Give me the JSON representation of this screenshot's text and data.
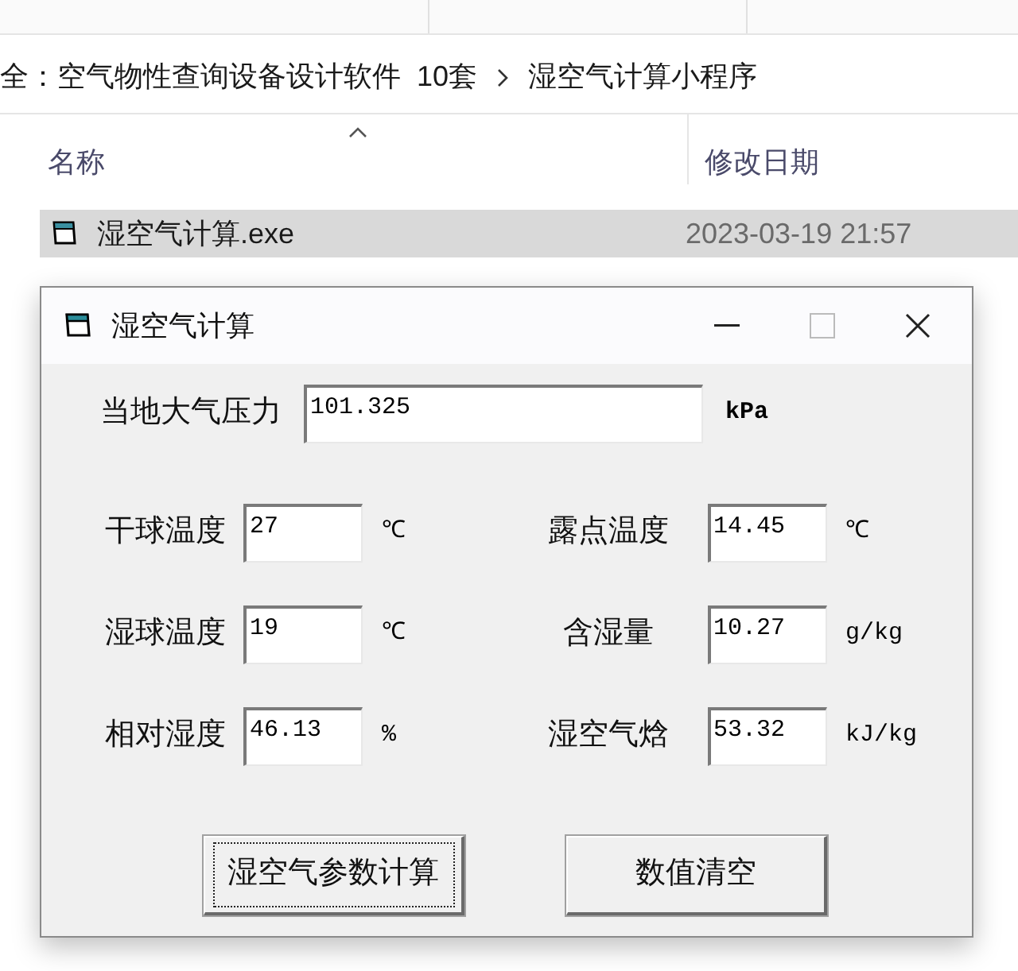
{
  "explorer": {
    "breadcrumb": [
      "全：空气物性查询设备设计软件  10套",
      "湿空气计算小程序"
    ],
    "columns": [
      {
        "label": "名称",
        "sorted": true
      },
      {
        "label": "修改日期",
        "sorted": false
      }
    ],
    "files": [
      {
        "name": "湿空气计算.exe",
        "date": "2023-03-19 21:57",
        "selected": true
      }
    ]
  },
  "dialog": {
    "title": "湿空气计算",
    "pressure": {
      "label": "当地大气压力",
      "value": "101.325",
      "unit": "kPa"
    },
    "fields": [
      {
        "label": "干球温度",
        "value": "27",
        "unit": "℃"
      },
      {
        "label": "露点温度",
        "value": "14.45",
        "unit": "℃"
      },
      {
        "label": "湿球温度",
        "value": "19",
        "unit": "℃"
      },
      {
        "label": "含湿量",
        "value": "10.27",
        "unit": "g/kg"
      },
      {
        "label": "相对湿度",
        "value": "46.13",
        "unit": "%"
      },
      {
        "label": "湿空气焓",
        "value": "53.32",
        "unit": "kJ/kg"
      }
    ],
    "buttons": [
      {
        "label": "湿空气参数计算",
        "focused": true
      },
      {
        "label": "数值清空",
        "focused": false
      }
    ]
  }
}
